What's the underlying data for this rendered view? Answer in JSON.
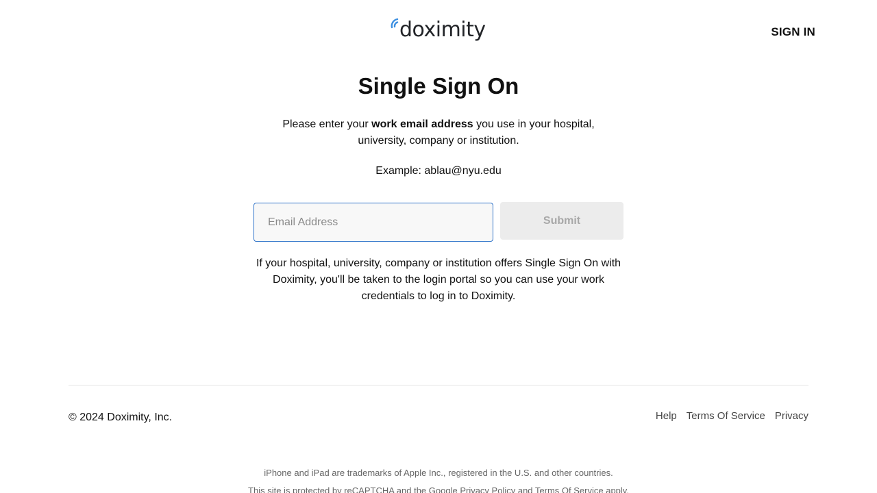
{
  "header": {
    "logo_text": "doximity",
    "signin_label": "SIGN IN"
  },
  "main": {
    "title": "Single Sign On",
    "intro_prefix": "Please enter your ",
    "intro_bold": "work email address",
    "intro_suffix": " you use in your hospital, university, company or institution.",
    "example": "Example: ablau@nyu.edu",
    "email_placeholder": "Email Address",
    "email_value": "",
    "submit_label": "Submit",
    "note": "If your hospital, university, company or institution offers Single Sign On with Doximity, you'll be taken to the login portal so you can use your work credentials to log in to Doximity."
  },
  "footer": {
    "copyright": "© 2024 Doximity, Inc.",
    "links": [
      "Help",
      "Terms Of Service",
      "Privacy"
    ],
    "legal_line1": "iPhone and iPad are trademarks of Apple Inc., registered in the U.S. and other countries.",
    "legal_line2_prefix": "This site is protected by reCAPTCHA and the ",
    "legal_line2_privacy": "Google Privacy Policy",
    "legal_line2_mid": " and ",
    "legal_line2_terms": "Terms Of Service",
    "legal_line2_suffix": " apply."
  },
  "colors": {
    "brand_blue": "#2f73c9",
    "logo_arc_blue": "#3b8ee0",
    "text": "#111111",
    "submit_disabled_bg": "#ececec",
    "submit_disabled_text": "#a8a8a8"
  },
  "icons": {
    "logo_mark": "doximity-signal-icon"
  }
}
